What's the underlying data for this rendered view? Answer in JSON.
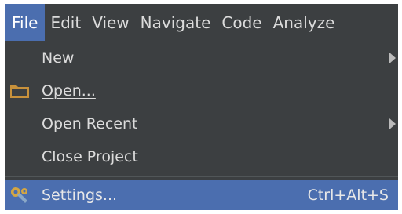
{
  "menubar": {
    "items": [
      {
        "label": "File",
        "active": true
      },
      {
        "label": "Edit",
        "active": false
      },
      {
        "label": "View",
        "active": false
      },
      {
        "label": "Navigate",
        "active": false
      },
      {
        "label": "Code",
        "active": false
      },
      {
        "label": "Analyze",
        "active": false
      }
    ]
  },
  "file_menu": {
    "new_label": "New",
    "open_label": "Open...",
    "open_recent_label": "Open Recent",
    "close_project_label": "Close Project",
    "settings_label": "Settings...",
    "settings_shortcut": "Ctrl+Alt+S"
  },
  "icons": {
    "open": "folder-icon",
    "settings": "wrench-icon",
    "submenu": "chevron-right-icon"
  },
  "colors": {
    "menu_background": "#3c3f41",
    "selection": "#4b6eaf",
    "text": "#dcdcdc",
    "folder_icon": "#c8913b"
  }
}
